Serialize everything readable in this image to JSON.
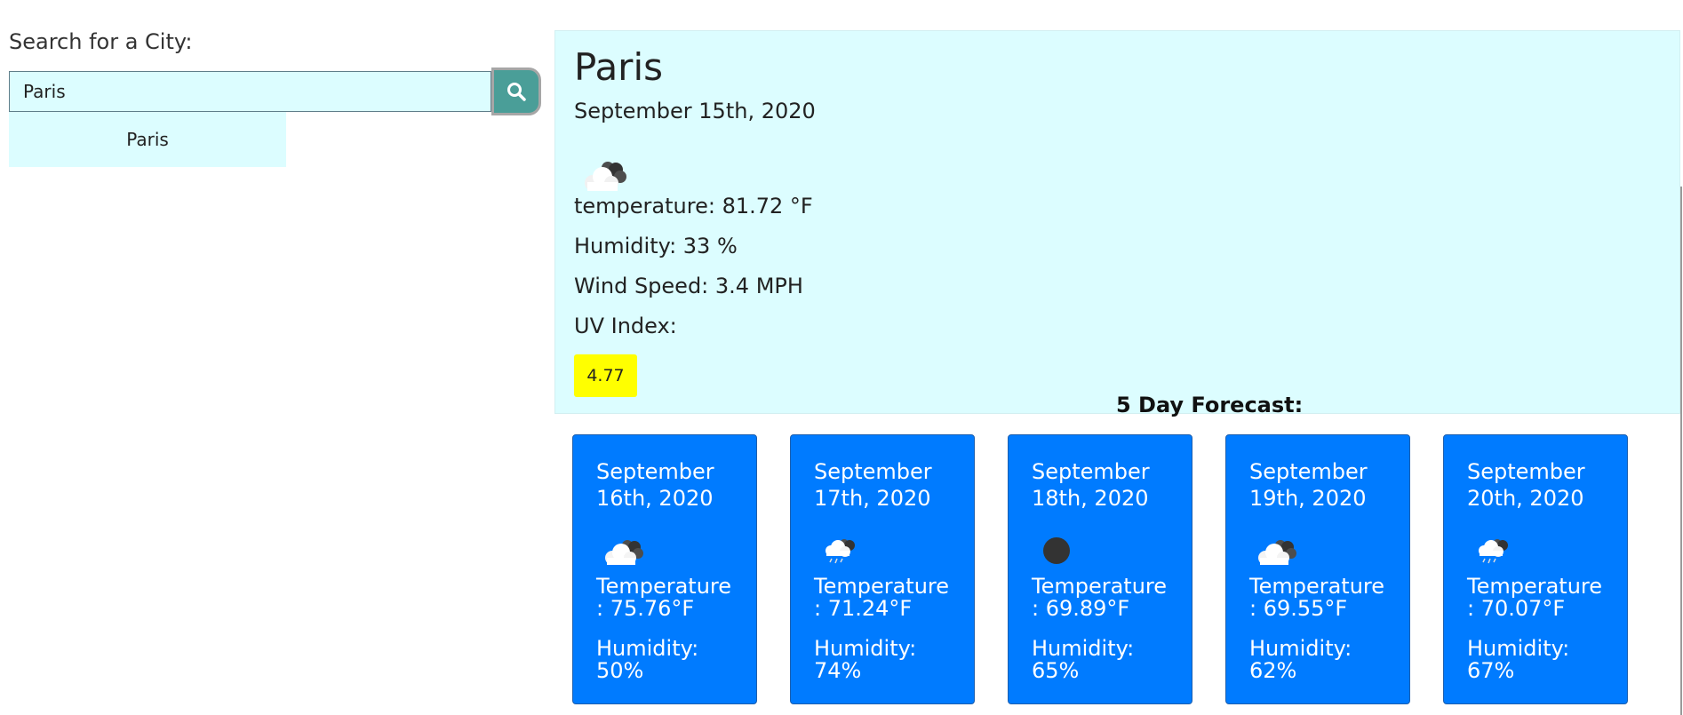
{
  "search": {
    "label": "Search for a City:",
    "value": "Paris",
    "suggestion": "Paris",
    "button_icon": "search-icon"
  },
  "current": {
    "city": "Paris",
    "date": "September 15th, 2020",
    "icon": "broken-clouds-icon",
    "temperature": "temperature: 81.72 °F",
    "humidity": "Humidity: 33 %",
    "wind": "Wind Speed: 3.4 MPH",
    "uv_label": "UV Index:",
    "uv_value": "4.77",
    "uv_color": "#ffff00"
  },
  "forecast": {
    "title": "5 Day Forecast:",
    "days": [
      {
        "date": "September 16th, 2020",
        "icon": "broken-clouds-icon",
        "temperature": "Temperature\n: 75.76°F",
        "humidity": "Humidity:\n50%"
      },
      {
        "date": "September 17th, 2020",
        "icon": "rain-icon",
        "temperature": "Temperature\n: 71.24°F",
        "humidity": "Humidity:\n74%"
      },
      {
        "date": "September 18th, 2020",
        "icon": "clear-sky-icon",
        "temperature": "Temperature\n: 69.89°F",
        "humidity": "Humidity:\n65%"
      },
      {
        "date": "September 19th, 2020",
        "icon": "broken-clouds-icon",
        "temperature": "Temperature\n: 69.55°F",
        "humidity": "Humidity:\n62%"
      },
      {
        "date": "September 20th, 2020",
        "icon": "rain-icon",
        "temperature": "Temperature\n: 70.07°F",
        "humidity": "Humidity:\n67%"
      }
    ]
  },
  "colors": {
    "panel_background": "#dcfdff",
    "card_background": "#007bff",
    "search_button": "#4a9e98"
  }
}
